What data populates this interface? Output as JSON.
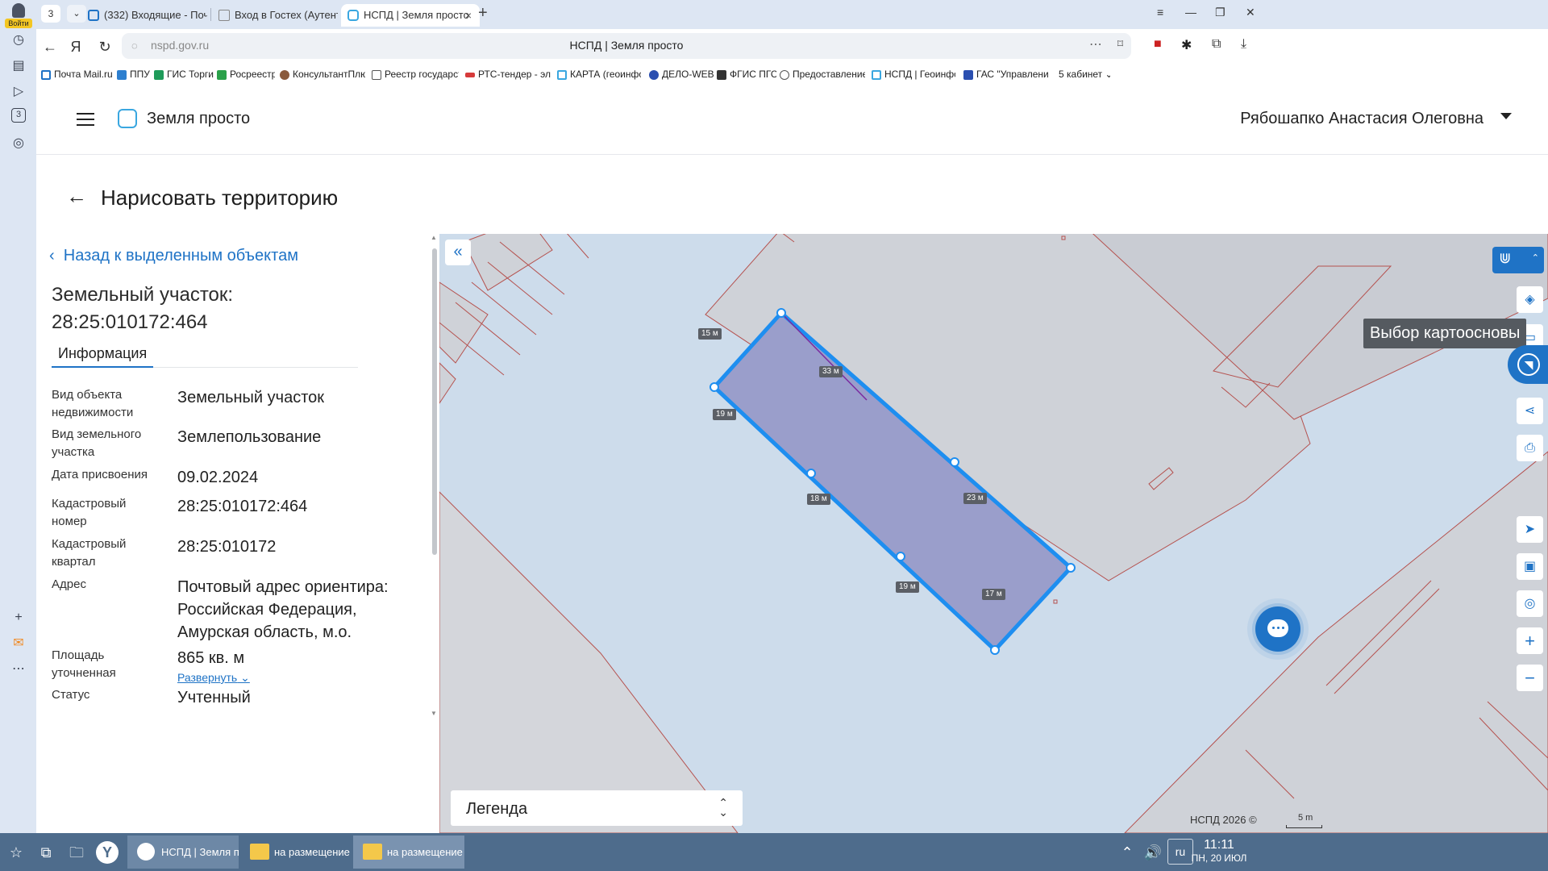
{
  "browser": {
    "login_label": "Войти",
    "tab_count": "3",
    "tabs": [
      {
        "label": "(332) Входящие - Почта Mail.ru"
      },
      {
        "label": "Вход в Гостех (Аутентификация)"
      },
      {
        "label": "НСПД | Земля просто"
      }
    ],
    "url": "nspd.gov.ru",
    "page_title": "НСПД | Земля просто",
    "bookmarks": [
      "Почта Mail.ru",
      "ППУ",
      "ГИС Торги",
      "Росреестр",
      "КонсультантПлюс",
      "Реестр государст",
      "РТС-тендер - эле",
      "КАРТА (геоинфор",
      "ДЕЛО-WEB",
      "ФГИС ПГС",
      "Предоставление",
      "НСПД | Геоинфор",
      "ГАС \"Управление",
      "5 кабинет"
    ],
    "rail_badge": "3"
  },
  "app": {
    "brand": "Земля просто",
    "user": "Рябошапко Анастасия Олеговна",
    "page_title": "Нарисовать территорию"
  },
  "panel": {
    "back_link": "Назад к выделенным объектам",
    "object_title": "Земельный участок: 28:25:010172:464",
    "tab": "Информация",
    "rows": [
      {
        "key": "Вид объекта недвижимости",
        "value": "Земельный участок"
      },
      {
        "key": "Вид земельного участка",
        "value": "Землепользование"
      },
      {
        "key": "Дата присвоения",
        "value": "09.02.2024"
      },
      {
        "key": "Кадастровый номер",
        "value": "28:25:010172:464"
      },
      {
        "key": "Кадастровый квартал",
        "value": "28:25:010172"
      },
      {
        "key": "Адрес",
        "value": "Почтовый адрес ориентира: Российская Федерация, Амурская область, м.о."
      },
      {
        "key": "Площадь уточненная",
        "value": "865 кв. м"
      },
      {
        "key": "Статус",
        "value": "Учтенный"
      }
    ],
    "expand_label": "Развернуть"
  },
  "map": {
    "tooltip": "Выбор картоосновы",
    "legend": "Легенда",
    "copyright": "НСПД 2026 ©",
    "scale": "5 m",
    "edge_labels": [
      "15 м",
      "33 м",
      "19 м",
      "18 м",
      "23 м",
      "19 м",
      "17 м"
    ],
    "colors": {
      "parcel_fill": "#9a9ecb",
      "parcel_stroke": "#1e8ef0",
      "accent": "#1f73c6"
    }
  },
  "taskbar": {
    "windows": [
      {
        "label": "НСПД | Земля пр..."
      },
      {
        "label": "на размещение ..."
      },
      {
        "label": "на размещение ..."
      }
    ],
    "lang": "ru",
    "time": "11:11",
    "date": "ПН, 20 ИЮЛ"
  }
}
